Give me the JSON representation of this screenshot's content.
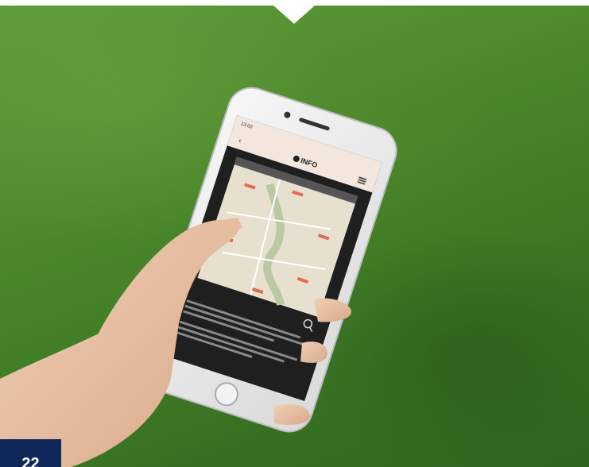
{
  "page_badge": {
    "number": "22"
  },
  "phone": {
    "status_time": "13:00",
    "app_title": "INFO",
    "back_icon": "chevron-left-icon",
    "menu_icon": "hamburger-menu-icon",
    "search_icon": "search-icon"
  },
  "colors": {
    "grass": "#4c8a2c",
    "badge": "#10275a",
    "app_header": "#f3e6dd",
    "app_body": "#222222",
    "map_base": "#e8e0cf",
    "map_marker": "#e26a55"
  }
}
